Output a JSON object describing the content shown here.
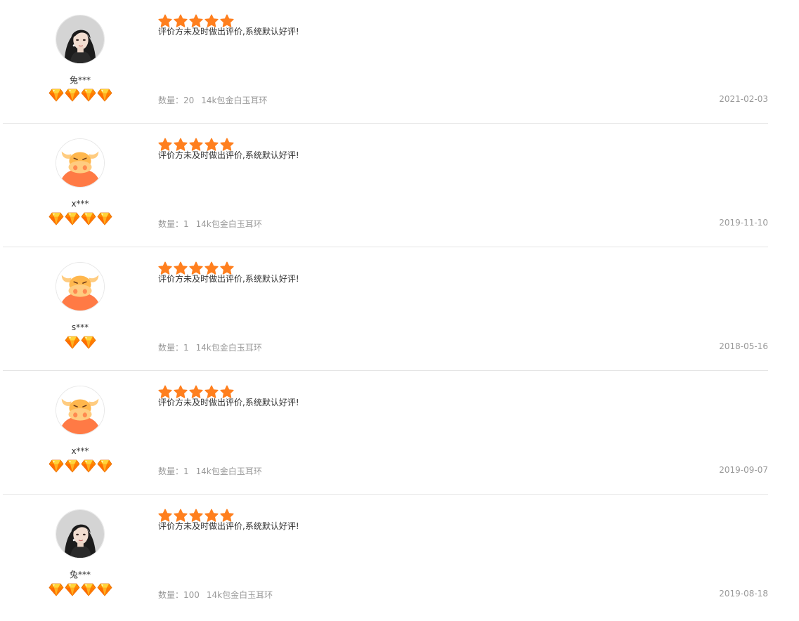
{
  "colors": {
    "star": "#ff7f1e",
    "divider": "#e5e5e5",
    "meta": "#999999"
  },
  "reviews": [
    {
      "avatar": "woman-photo",
      "username": "兔***",
      "badge_count": 4,
      "rating": 5,
      "comment": "评价方未及时做出评价,系统默认好评!",
      "quantity_label": "数量：20",
      "product": "14k包金白玉耳环",
      "date": "2021-02-03"
    },
    {
      "avatar": "bull-mascot",
      "username": "x***",
      "badge_count": 4,
      "rating": 5,
      "comment": "评价方未及时做出评价,系统默认好评!",
      "quantity_label": "数量：1",
      "product": "14k包金白玉耳环",
      "date": "2019-11-10"
    },
    {
      "avatar": "bull-mascot",
      "username": "s***",
      "badge_count": 2,
      "rating": 5,
      "comment": "评价方未及时做出评价,系统默认好评!",
      "quantity_label": "数量：1",
      "product": "14k包金白玉耳环",
      "date": "2018-05-16"
    },
    {
      "avatar": "bull-mascot",
      "username": "x***",
      "badge_count": 4,
      "rating": 5,
      "comment": "评价方未及时做出评价,系统默认好评!",
      "quantity_label": "数量：1",
      "product": "14k包金白玉耳环",
      "date": "2019-09-07"
    },
    {
      "avatar": "woman-photo",
      "username": "兔***",
      "badge_count": 4,
      "rating": 5,
      "comment": "评价方未及时做出评价,系统默认好评!",
      "quantity_label": "数量：100",
      "product": "14k包金白玉耳环",
      "date": "2019-08-18"
    }
  ]
}
